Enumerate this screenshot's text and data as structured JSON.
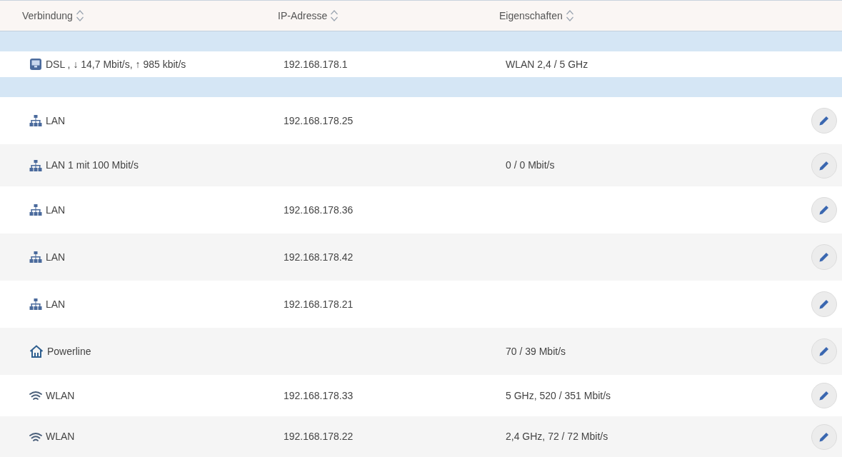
{
  "table": {
    "columns": [
      "Verbindung",
      "IP-Adresse",
      "Eigenschaften"
    ],
    "internet": [
      {
        "kind": "dsl",
        "connection": "DSL , ↓ 14,7 Mbit/s, ↑ 985 kbit/s",
        "ip": "192.168.178.1",
        "properties": "WLAN 2,4 / 5 GHz"
      }
    ],
    "devices": [
      {
        "kind": "lan",
        "connection": "LAN",
        "ip": "192.168.178.25"
      },
      {
        "kind": "lan",
        "connection": "LAN 1 mit 100 Mbit/s",
        "properties": "0 / 0 Mbit/s"
      },
      {
        "kind": "lan",
        "connection": "LAN",
        "ip": "192.168.178.36"
      },
      {
        "kind": "lan",
        "connection": "LAN",
        "ip": "192.168.178.42"
      },
      {
        "kind": "lan",
        "connection": "LAN",
        "ip": "192.168.178.21"
      },
      {
        "kind": "powerline",
        "connection": "Powerline",
        "properties": "70 / 39 Mbit/s"
      },
      {
        "kind": "wlan",
        "connection": "WLAN",
        "ip": "192.168.178.33",
        "properties": "5 GHz, 520 / 351 Mbit/s"
      },
      {
        "kind": "wlan",
        "connection": "WLAN",
        "ip": "192.168.178.22",
        "properties": "2,4 GHz, 72 / 72 Mbit/s"
      }
    ]
  }
}
